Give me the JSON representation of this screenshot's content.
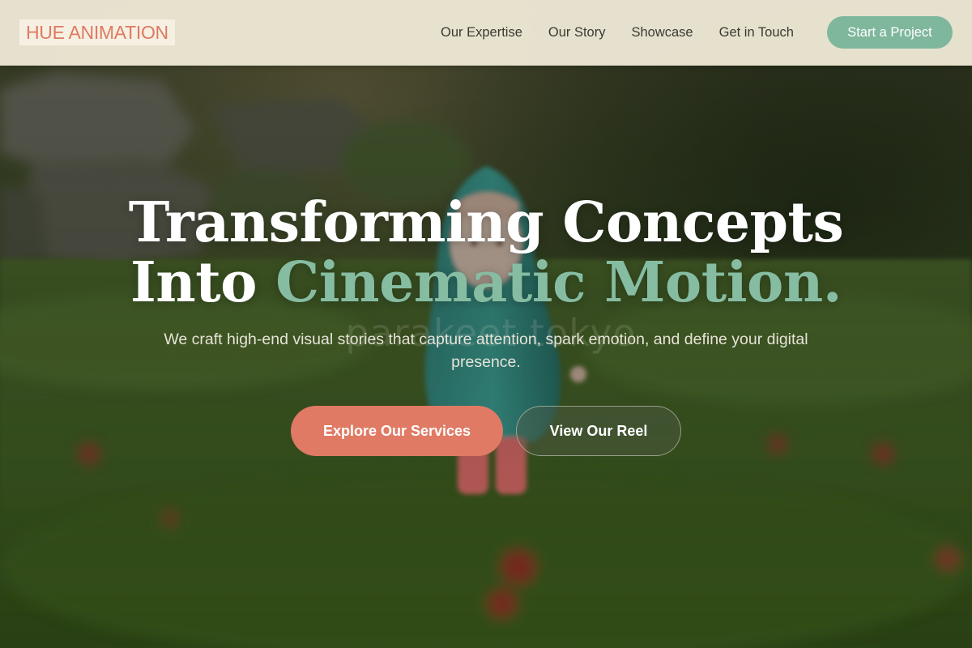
{
  "brand": {
    "logo_text": "HUE ANIMATION"
  },
  "nav": {
    "links": [
      {
        "label": "Our Expertise"
      },
      {
        "label": "Our Story"
      },
      {
        "label": "Showcase"
      },
      {
        "label": "Get in Touch"
      }
    ],
    "cta_label": "Start a Project"
  },
  "hero": {
    "title_line1": "Transforming Concepts",
    "title_line2_plain": "Into ",
    "title_line2_accent": "Cinematic Motion.",
    "subtitle": "We craft high-end visual stories that capture attention, spark emotion, and define your digital presence.",
    "primary_button": "Explore Our Services",
    "secondary_button": "View Our Reel",
    "watermark": "parakeet tokyo"
  },
  "colors": {
    "accent_coral": "#e07a64",
    "accent_green": "#86bda2",
    "header_bg": "#ece7d4",
    "cta_green": "#7fb79d"
  }
}
